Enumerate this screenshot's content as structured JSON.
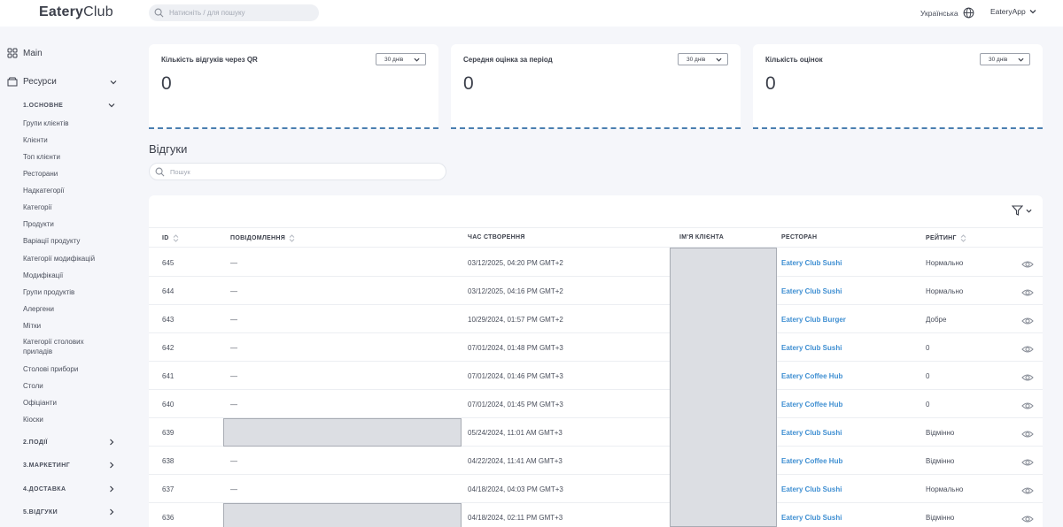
{
  "header": {
    "logo_bold": "Eatery",
    "logo_light": "Club",
    "search_placeholder": "Натисніть / для пошуку",
    "language": "Українська",
    "user": "EateryApp"
  },
  "sidebar": {
    "main": "Main",
    "resources": "Ресурси",
    "section1": "1.ОСНОВНЕ",
    "items": [
      "Групи клієнтів",
      "Клієнти",
      "Топ клієнти",
      "Ресторани",
      "Надкатегорії",
      "Категорії",
      "Продукти",
      "Варіації продукту",
      "Категорії модифікацій",
      "Модифікації",
      "Групи продуктів",
      "Алергени",
      "Мітки",
      "Категорії столових приладів",
      "Столові прибори",
      "Столи",
      "Офіціанти",
      "Кіоски"
    ],
    "sections": [
      "2.ПОДІЇ",
      "3.МАРКЕТИНГ",
      "4.ДОСТАВКА",
      "5.ВІДГУКИ"
    ]
  },
  "cards": [
    {
      "title": "Кількість відгуків через QR",
      "period": "30 днів",
      "value": "0"
    },
    {
      "title": "Середня оцінка за період",
      "period": "30 днів",
      "value": "0"
    },
    {
      "title": "Кількість оцінок",
      "period": "30 днів",
      "value": "0"
    }
  ],
  "reviews": {
    "title": "Відгуки",
    "search_placeholder": "Пошук",
    "columns": [
      "ID",
      "ПОВІДОМЛЕННЯ",
      "ЧАС СТВОРЕННЯ",
      "ІМ'Я КЛІЄНТА",
      "РЕСТОРАН",
      "РЕЙТИНГ"
    ],
    "rows": [
      {
        "id": "645",
        "message": "—",
        "created": "03/12/2025, 04:20 PM GMT+2",
        "restaurant": "Eatery Club Sushi",
        "rating": "Нормально"
      },
      {
        "id": "644",
        "message": "—",
        "created": "03/12/2025, 04:16 PM GMT+2",
        "restaurant": "Eatery Club Sushi",
        "rating": "Нормально"
      },
      {
        "id": "643",
        "message": "—",
        "created": "10/29/2024, 01:57 PM GMT+2",
        "restaurant": "Eatery Club Burger",
        "rating": "Добре"
      },
      {
        "id": "642",
        "message": "—",
        "created": "07/01/2024, 01:48 PM GMT+3",
        "restaurant": "Eatery Club Sushi",
        "rating": "0"
      },
      {
        "id": "641",
        "message": "—",
        "created": "07/01/2024, 01:46 PM GMT+3",
        "restaurant": "Eatery Coffee Hub",
        "rating": "0"
      },
      {
        "id": "640",
        "message": "—",
        "created": "07/01/2024, 01:45 PM GMT+3",
        "restaurant": "Eatery Coffee Hub",
        "rating": "0"
      },
      {
        "id": "639",
        "message": "",
        "created": "05/24/2024, 11:01 AM GMT+3",
        "restaurant": "Eatery Club Sushi",
        "rating": "Відмінно"
      },
      {
        "id": "638",
        "message": "—",
        "created": "04/22/2024, 11:41 AM GMT+3",
        "restaurant": "Eatery Coffee Hub",
        "rating": "Відмінно"
      },
      {
        "id": "637",
        "message": "—",
        "created": "04/18/2024, 04:03 PM GMT+3",
        "restaurant": "Eatery Club Sushi",
        "rating": "Нормально"
      },
      {
        "id": "636",
        "message": "",
        "created": "04/18/2024, 02:11 PM GMT+3",
        "restaurant": "Eatery Club Sushi",
        "rating": "Відмінно"
      }
    ]
  },
  "colors": {
    "accent": "#3f8fd2",
    "chart_line": "#4a7fb0",
    "redaction": "#dcdee3"
  }
}
